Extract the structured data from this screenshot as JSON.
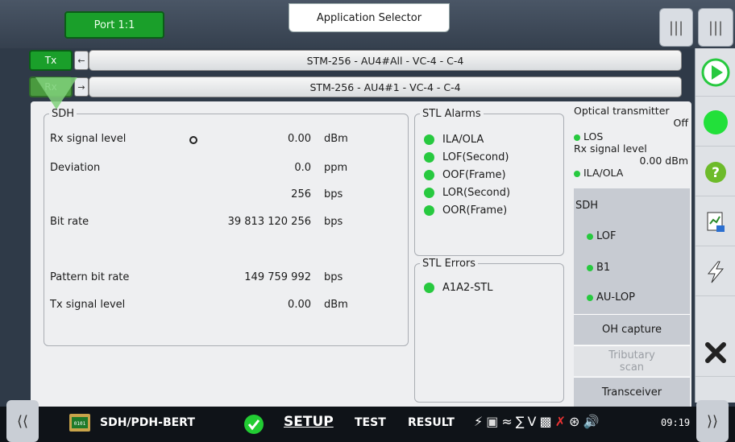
{
  "header": {
    "port_label": "Port 1:1",
    "app_selector": "Application Selector"
  },
  "channels": {
    "tx_label": "Tx",
    "tx_path": "STM-256 - AU4#All - VC-4 - C-4",
    "rx_label": "Rx",
    "rx_path": "STM-256 - AU4#1 - VC-4 - C-4"
  },
  "sdh": {
    "legend": "SDH",
    "rows": [
      {
        "label": "Rx signal level",
        "value": "0.00",
        "unit": "dBm"
      },
      {
        "label": "Deviation",
        "value": "0.0",
        "unit": "ppm"
      },
      {
        "label": "",
        "value": "256",
        "unit": "bps"
      },
      {
        "label": "Bit rate",
        "value": "39 813 120 256",
        "unit": "bps"
      },
      {
        "label": "Pattern bit rate",
        "value": "149 759 992",
        "unit": "bps"
      },
      {
        "label": "Tx signal level",
        "value": "0.00",
        "unit": "dBm"
      }
    ]
  },
  "stl_alarms": {
    "legend": "STL Alarms",
    "items": [
      "ILA/OLA",
      "LOF(Second)",
      "OOF(Frame)",
      "LOR(Second)",
      "OOR(Frame)"
    ]
  },
  "stl_errors": {
    "legend": "STL Errors",
    "items": [
      "A1A2-STL"
    ]
  },
  "status_panel": {
    "optical_title": "Optical transmitter",
    "optical_state": "Off",
    "los": "LOS",
    "rx_level_label": "Rx signal level",
    "rx_level_value": "0.00 dBm",
    "ila": "ILA/OLA",
    "sdh_title": "SDH",
    "sdh_items": [
      "LOF",
      "B1",
      "AU-LOP"
    ],
    "oh_capture": "OH capture",
    "tributary_scan": "Tributary scan",
    "transceiver": "Transceiver"
  },
  "bottom": {
    "app_name": "SDH/PDH-BERT",
    "setup": "SETUP",
    "test": "TEST",
    "result": "RESULT",
    "time": "09:19"
  },
  "colors": {
    "green": "#27c93f",
    "tab_green": "#1a9f2a",
    "panel": "#eeeff1"
  }
}
